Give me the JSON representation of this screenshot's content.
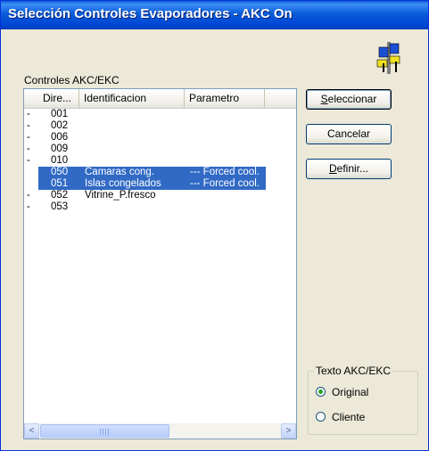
{
  "window": {
    "title": "Selección Controles Evaporadores - AKC On"
  },
  "group_label": "Controles AKC/EKC",
  "list": {
    "columns": [
      "Dire...",
      "Identificacion",
      "Parametro"
    ],
    "rows": [
      {
        "bullet": "-",
        "dir": "001",
        "ident": "",
        "param": "",
        "selected": false
      },
      {
        "bullet": "-",
        "dir": "002",
        "ident": "",
        "param": "",
        "selected": false
      },
      {
        "bullet": "-",
        "dir": "006",
        "ident": "",
        "param": "",
        "selected": false
      },
      {
        "bullet": "-",
        "dir": "009",
        "ident": "",
        "param": "",
        "selected": false
      },
      {
        "bullet": "-",
        "dir": "010",
        "ident": "",
        "param": "",
        "selected": false
      },
      {
        "bullet": "",
        "dir": "050",
        "ident": "Camaras cong.",
        "param": "--- Forced cool.",
        "selected": true
      },
      {
        "bullet": "",
        "dir": "051",
        "ident": "Islas congelados",
        "param": "--- Forced cool.",
        "selected": true
      },
      {
        "bullet": "-",
        "dir": "052",
        "ident": "Vitrine_P.fresco",
        "param": "",
        "selected": false
      },
      {
        "bullet": "-",
        "dir": "053",
        "ident": "",
        "param": "",
        "selected": false
      }
    ]
  },
  "buttons": {
    "select": {
      "accel": "S",
      "rest": "eleccionar"
    },
    "cancel": {
      "label": "Cancelar"
    },
    "define": {
      "accel": "D",
      "rest": "efinir..."
    }
  },
  "texto_group": {
    "legend": "Texto AKC/EKC",
    "options": [
      {
        "label": "Original",
        "checked": true
      },
      {
        "label": "Cliente",
        "checked": false
      }
    ]
  },
  "scrollbar": {
    "left_arrow": "<",
    "right_arrow": ">"
  },
  "colors": {
    "titlebar": "#0a5bd8",
    "selection": "#316ac5",
    "window_bg": "#ece9d8"
  }
}
